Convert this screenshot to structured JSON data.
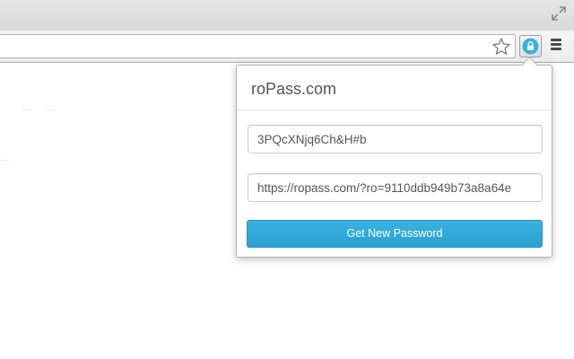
{
  "browser": {
    "resize_icon": "fullscreen-arrows-icon",
    "star_icon": "bookmark-star-icon",
    "extension_icon": "lock-icon",
    "menu_icon": "hamburger-menu-icon"
  },
  "popup": {
    "title": "roPass.com",
    "password_value": "3PQcXNjq6Ch&H#b",
    "url_value": "https://ropass.com/?ro=9110ddb949b73a8a64e",
    "button_label": "Get New Password"
  },
  "colors": {
    "accent": "#2fa8d8",
    "title_text": "#555555"
  }
}
